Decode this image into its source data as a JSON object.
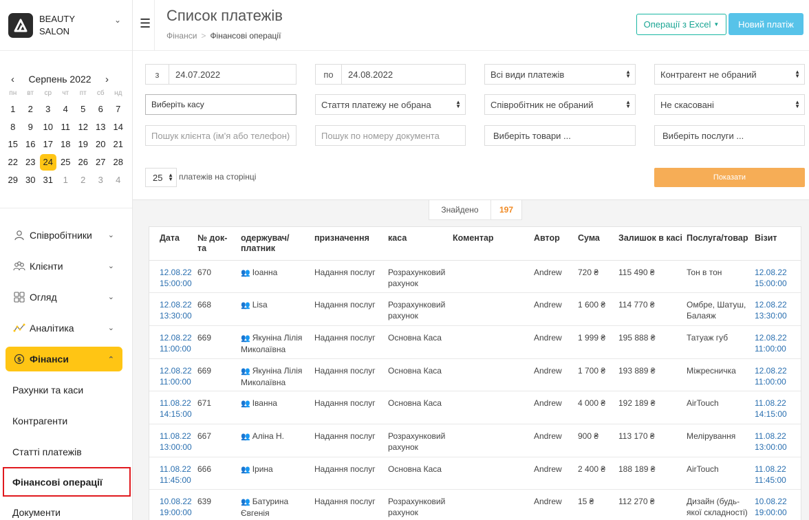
{
  "brand": {
    "line1": "BEAUTY",
    "line2": "SALON"
  },
  "calendar": {
    "month": "Серпень 2022",
    "weekdays": [
      "пн",
      "вт",
      "ср",
      "чт",
      "пт",
      "сб",
      "нд"
    ],
    "weeks": [
      [
        "1",
        "2",
        "3",
        "4",
        "5",
        "6",
        "7"
      ],
      [
        "8",
        "9",
        "10",
        "11",
        "12",
        "13",
        "14"
      ],
      [
        "15",
        "16",
        "17",
        "18",
        "19",
        "20",
        "21"
      ],
      [
        "22",
        "23",
        "24",
        "25",
        "26",
        "27",
        "28"
      ],
      [
        "29",
        "30",
        "31",
        "1",
        "2",
        "3",
        "4"
      ]
    ],
    "selected": "24"
  },
  "menu": {
    "employees": "Співробітники",
    "clients": "Клієнти",
    "overview": "Огляд",
    "analytics": "Аналітика",
    "finance": "Фінанси",
    "sub": {
      "accounts": "Рахунки та каси",
      "contractors": "Контрагенти",
      "articles": "Статті платежів",
      "operations": "Фінансові операції",
      "documents": "Документи"
    }
  },
  "header": {
    "title": "Список платежів",
    "crumb1": "Фінанси",
    "crumb2": "Фінансові операції",
    "excel_button": "Операції з Excel",
    "new_button": "Новий платіж"
  },
  "filters": {
    "from_label": "з",
    "from_value": "24.07.2022",
    "to_label": "по",
    "to_value": "24.08.2022",
    "payment_types": "Всі види платежів",
    "contractor": "Контрагент не обраний",
    "cashbox": "Виберіть касу",
    "article": "Стаття платежу не обрана",
    "employee": "Співробітник не обраний",
    "cancelled": "Не скасовані",
    "client_search": "Пошук клієнта (ім'я або телефон)",
    "doc_search": "Пошук по номеру документа",
    "goods": "Виберіть товари ...",
    "services": "Виберіть послуги ...",
    "per_page": "25",
    "per_page_label": "платежів на сторінці",
    "show_button": "Показати"
  },
  "found": {
    "label": "Знайдено",
    "count": "197"
  },
  "table": {
    "columns": {
      "date": "Дата",
      "doc": "№ док-та",
      "payer": "одержувач/ платник",
      "purpose": "призначення",
      "cashbox": "каса",
      "comment": "Коментар",
      "author": "Автор",
      "sum": "Сума",
      "balance": "Залишок в касі",
      "service": "Послуга/товар",
      "visit": "Візит"
    },
    "rows": [
      {
        "date": "12.08.22",
        "time": "15:00:00",
        "doc": "670",
        "payer": "Іоанна",
        "purpose": "Надання послуг",
        "cashbox": "Розрахунковий рахунок",
        "comment": "",
        "author": "Andrew",
        "sum": "720 ₴",
        "balance": "115 490 ₴",
        "service": "Тон в тон",
        "vdate": "12.08.22",
        "vtime": "15:00:00"
      },
      {
        "date": "12.08.22",
        "time": "13:30:00",
        "doc": "668",
        "payer": "Lisa",
        "purpose": "Надання послуг",
        "cashbox": "Розрахунковий рахунок",
        "comment": "",
        "author": "Andrew",
        "sum": "1 600 ₴",
        "balance": "114 770 ₴",
        "service": "Омбре, Шатуш, Балаяж",
        "vdate": "12.08.22",
        "vtime": "13:30:00"
      },
      {
        "date": "12.08.22",
        "time": "11:00:00",
        "doc": "669",
        "payer": "Якуніна Лілія Миколаївна",
        "purpose": "Надання послуг",
        "cashbox": "Основна Каса",
        "comment": "",
        "author": "Andrew",
        "sum": "1 999 ₴",
        "balance": "195 888 ₴",
        "service": "Татуаж губ",
        "vdate": "12.08.22",
        "vtime": "11:00:00"
      },
      {
        "date": "12.08.22",
        "time": "11:00:00",
        "doc": "669",
        "payer": "Якуніна Лілія Миколаївна",
        "purpose": "Надання послуг",
        "cashbox": "Основна Каса",
        "comment": "",
        "author": "Andrew",
        "sum": "1 700 ₴",
        "balance": "193 889 ₴",
        "service": "Міжресничка",
        "vdate": "12.08.22",
        "vtime": "11:00:00"
      },
      {
        "date": "11.08.22",
        "time": "14:15:00",
        "doc": "671",
        "payer": "Іванна",
        "purpose": "Надання послуг",
        "cashbox": "Основна Каса",
        "comment": "",
        "author": "Andrew",
        "sum": "4 000 ₴",
        "balance": "192 189 ₴",
        "service": "AirTouch",
        "vdate": "11.08.22",
        "vtime": "14:15:00"
      },
      {
        "date": "11.08.22",
        "time": "13:00:00",
        "doc": "667",
        "payer": "Аліна Н.",
        "purpose": "Надання послуг",
        "cashbox": "Розрахунковий рахунок",
        "comment": "",
        "author": "Andrew",
        "sum": "900 ₴",
        "balance": "113 170 ₴",
        "service": "Мелірування",
        "vdate": "11.08.22",
        "vtime": "13:00:00"
      },
      {
        "date": "11.08.22",
        "time": "11:45:00",
        "doc": "666",
        "payer": "Ірина",
        "purpose": "Надання послуг",
        "cashbox": "Основна Каса",
        "comment": "",
        "author": "Andrew",
        "sum": "2 400 ₴",
        "balance": "188 189 ₴",
        "service": "AirTouch",
        "vdate": "11.08.22",
        "vtime": "11:45:00"
      },
      {
        "date": "10.08.22",
        "time": "19:00:00",
        "doc": "639",
        "payer": "Батурина Євгенія",
        "purpose": "Надання послуг",
        "cashbox": "Розрахунковий рахунок",
        "comment": "",
        "author": "Andrew",
        "sum": "15 ₴",
        "balance": "112 270 ₴",
        "service": "Дизайн (будь-якої складності)",
        "vdate": "10.08.22",
        "vtime": "19:00:00"
      }
    ]
  }
}
